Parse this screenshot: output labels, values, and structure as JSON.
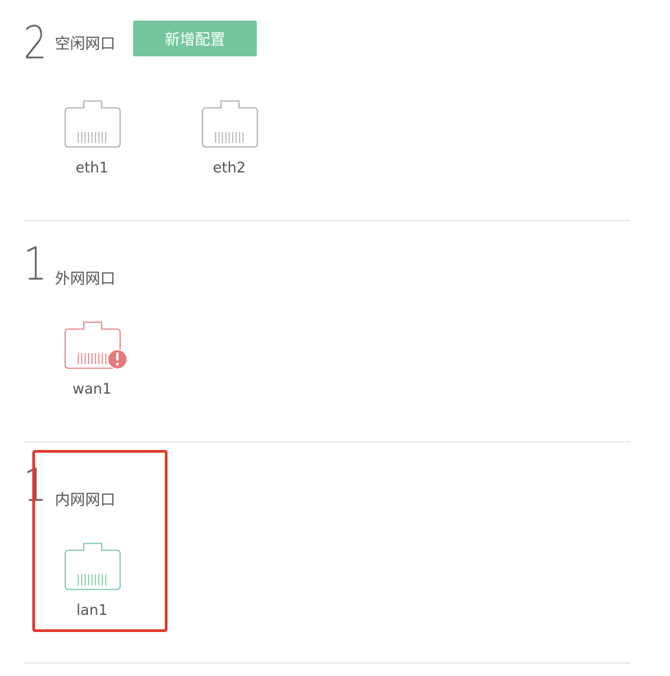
{
  "sections": [
    {
      "count": "2",
      "title": "空闲网口",
      "button_label": "新增配置",
      "ports": [
        {
          "name": "eth1",
          "status": "idle",
          "color": "#aaaaaa"
        },
        {
          "name": "eth2",
          "status": "idle",
          "color": "#aaaaaa"
        }
      ]
    },
    {
      "count": "1",
      "title": "外网网口",
      "ports": [
        {
          "name": "wan1",
          "status": "error",
          "color": "#e8787a"
        }
      ]
    },
    {
      "count": "1",
      "title": "内网网口",
      "ports": [
        {
          "name": "lan1",
          "status": "ok",
          "color": "#74c69d"
        }
      ]
    }
  ],
  "colors": {
    "accent": "#74c69d",
    "error": "#e8787a",
    "idle": "#aaaaaa",
    "highlight": "#e33b2e"
  }
}
